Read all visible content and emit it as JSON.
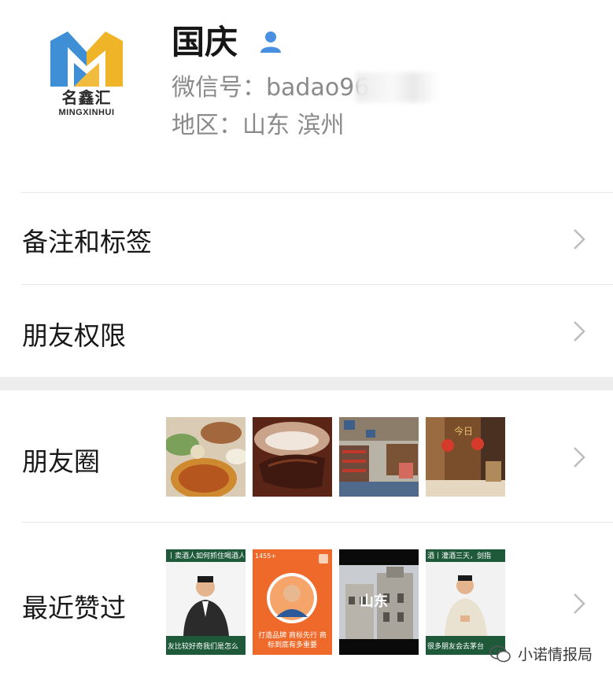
{
  "profile": {
    "name": "国庆",
    "wechat_id": "微信号：badao96",
    "region": "地区：山东 滨州",
    "avatar": {
      "logo_text_cn": "名鑫汇",
      "logo_text_en": "MINGXINHUI",
      "colors": {
        "blue": "#3f8fd6",
        "gold": "#f0b429"
      }
    },
    "verified_icon": "person-icon"
  },
  "rows": {
    "notes_tags": {
      "label": "备注和标签"
    },
    "friend_permissions": {
      "label": "朋友权限"
    },
    "moments": {
      "label": "朋友圈",
      "thumbnails": [
        "food-dishes",
        "braised-meat",
        "restaurant-interior",
        "festival-poster"
      ]
    },
    "recent_likes": {
      "label": "最近赞过",
      "thumbnails": [
        {
          "caption_top": "丨卖酒人如何抓住喝酒人",
          "caption_bottom": "友比较好奇我们是怎么"
        },
        {
          "caption_top": "1455+",
          "caption_bottom": "打造品牌 商标先行 商标到底有多重要"
        },
        {
          "caption_top": "",
          "caption_bottom": "山东"
        },
        {
          "caption_top": "酒丨灌酒三天，剑指",
          "caption_bottom": "很多朋友会去茅台"
        }
      ]
    }
  },
  "watermark": {
    "text": "小诺情报局",
    "icon": "wechat-official-account-icon"
  },
  "colors": {
    "background": "#ffffff",
    "section_gap": "#ededed",
    "secondary_text": "#8a8a8a",
    "chevron": "#bdbdbd"
  }
}
